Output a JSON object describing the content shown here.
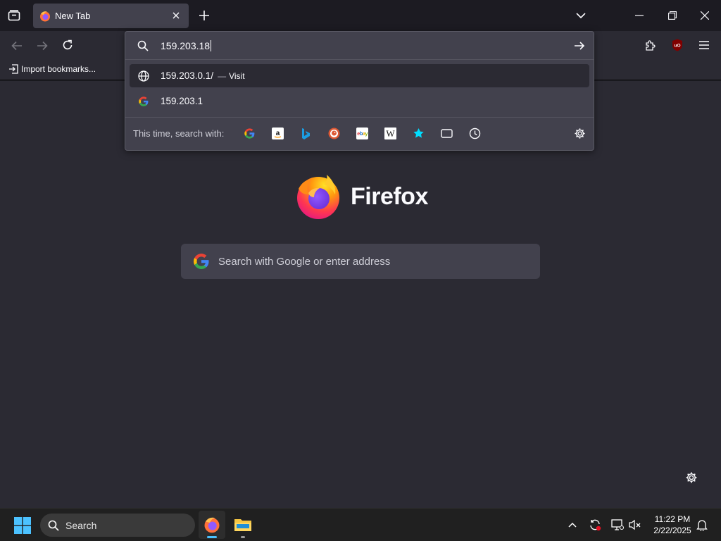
{
  "tab": {
    "title": "New Tab"
  },
  "bookmarks": {
    "import_label": "Import bookmarks..."
  },
  "urlbar": {
    "value": "159.203.18"
  },
  "suggestions": [
    {
      "text": "159.203.0.1/",
      "separator": "—",
      "action": "Visit",
      "icon": "globe-icon"
    },
    {
      "text": "159.203.1",
      "icon": "google-icon"
    }
  ],
  "oneoff": {
    "label": "This time, search with:",
    "engines": [
      "google",
      "amazon",
      "bing",
      "duckduckgo",
      "ebay",
      "wikipedia",
      "bookmarks",
      "tabs",
      "history"
    ]
  },
  "page": {
    "logo_text": "Firefox",
    "search_placeholder": "Search with Google or enter address"
  },
  "taskbar": {
    "search_label": "Search",
    "time": "11:22 PM",
    "date": "2/22/2025"
  },
  "colors": {
    "bg": "#2b2a33",
    "panel": "#42414d",
    "accent": "#00ddff",
    "firefox_orange": "#ff7139"
  }
}
